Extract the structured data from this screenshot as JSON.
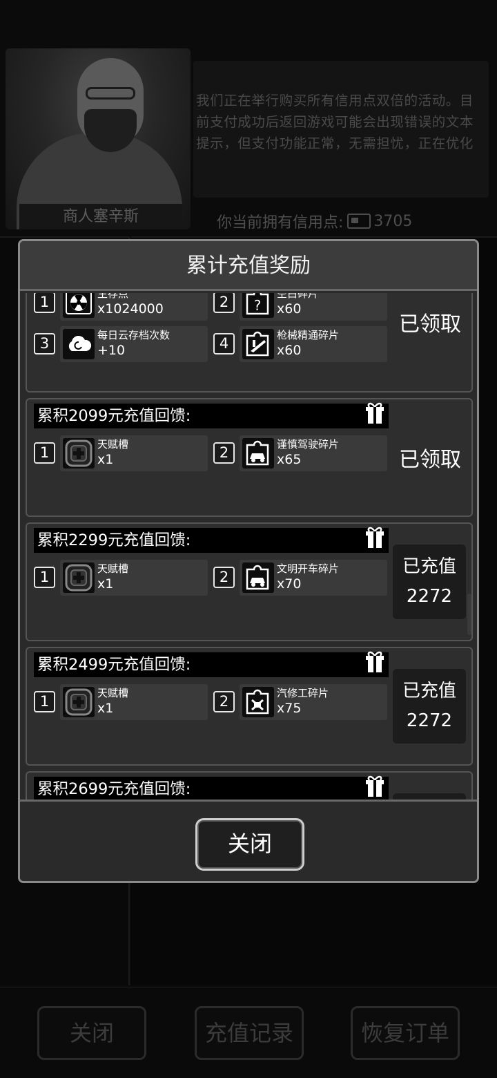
{
  "merchant": {
    "name": "商人塞辛斯",
    "message": "我们正在举行购买所有信用点双倍的活动。目前支付成功后返回游戏可能会出现错误的文本提示，但支付功能正常，无需担忧，正在优化",
    "credits_label": "你当前拥有信用点:",
    "credits_value": "3705"
  },
  "modal": {
    "title": "累计充值奖励",
    "close_label": "关闭",
    "cards": [
      {
        "title": "",
        "status": "已领取",
        "rewards": [
          {
            "index": "1",
            "name": "生存点",
            "qty": "x1024000",
            "icon": "radiation-icon"
          },
          {
            "index": "2",
            "name": "空白碎片",
            "qty": "x60",
            "icon": "puzzle-question-icon"
          },
          {
            "index": "3",
            "name": "每日云存档次数",
            "qty": "+10",
            "icon": "cloud-icon"
          },
          {
            "index": "4",
            "name": "枪械精通碎片",
            "qty": "x60",
            "icon": "puzzle-gun-icon"
          }
        ]
      },
      {
        "title": "累积2099元充值回馈:",
        "status": "已领取",
        "rewards": [
          {
            "index": "1",
            "name": "天赋槽",
            "qty": "x1",
            "icon": "talent-slot-icon"
          },
          {
            "index": "2",
            "name": "谨慎驾驶碎片",
            "qty": "x65",
            "icon": "puzzle-car-icon"
          }
        ]
      },
      {
        "title": "累积2299元充值回馈:",
        "status_label": "已充值",
        "status_value": "2272",
        "rewards": [
          {
            "index": "1",
            "name": "天赋槽",
            "qty": "x1",
            "icon": "talent-slot-icon"
          },
          {
            "index": "2",
            "name": "文明开车碎片",
            "qty": "x70",
            "icon": "puzzle-car-icon"
          }
        ]
      },
      {
        "title": "累积2499元充值回馈:",
        "status_label": "已充值",
        "status_value": "2272",
        "rewards": [
          {
            "index": "1",
            "name": "天赋槽",
            "qty": "x1",
            "icon": "talent-slot-icon"
          },
          {
            "index": "2",
            "name": "汽修工碎片",
            "qty": "x75",
            "icon": "puzzle-wrench-icon"
          }
        ]
      },
      {
        "title": "累积2699元充值回馈:"
      }
    ]
  },
  "bottom_buttons": {
    "close": "关闭",
    "history": "充值记录",
    "restore": "恢复订单"
  }
}
